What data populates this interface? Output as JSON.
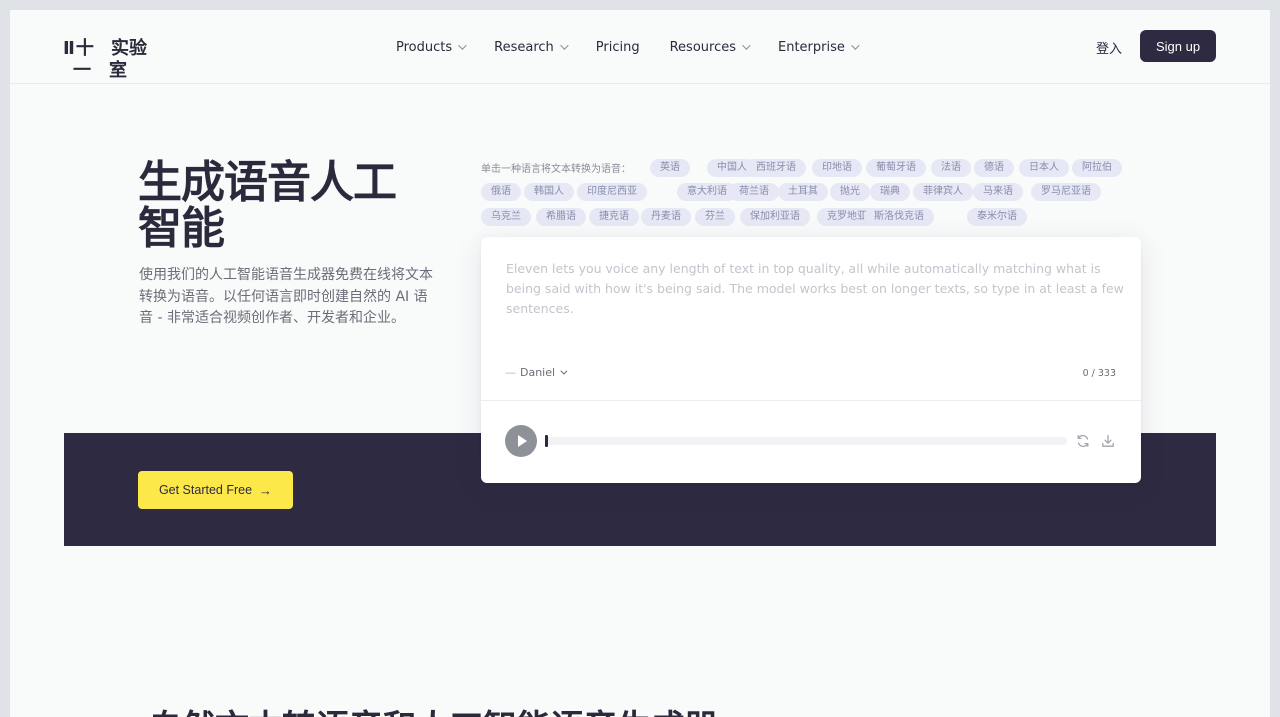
{
  "logo": {
    "line1_left": "Ⅱ十",
    "line1_right": "实验",
    "line2_left": "一",
    "line2_right": "室"
  },
  "nav": [
    {
      "label": "Products",
      "dropdown": true
    },
    {
      "label": "Research",
      "dropdown": true
    },
    {
      "label": "Pricing",
      "dropdown": false
    },
    {
      "label": "Resources",
      "dropdown": true
    },
    {
      "label": "Enterprise",
      "dropdown": true
    }
  ],
  "header": {
    "login_label": "登入",
    "signup_label": "Sign up"
  },
  "hero": {
    "title": " 生成语音人工智能",
    "description": "使用我们的人工智能语音生成器免费在线将文本转换为语音。以任何语言即时创建自然的 AI 语音 - 非常适合视频创作者、开发者和企业。",
    "cta_label": "Get Started Free"
  },
  "languages": {
    "prompt": "单击一种语言将文本转换为语音：",
    "items": [
      "英语",
      "中国人",
      "西班牙语",
      "印地语",
      "葡萄牙语",
      "法语",
      "德语",
      "日本人",
      "阿拉伯",
      "俄语",
      "韩国人",
      "印度尼西亚",
      "意大利语",
      "荷兰语",
      "土耳其",
      "抛光",
      "瑞典",
      "菲律宾人",
      "马来语",
      "罗马尼亚语",
      "乌克兰",
      "希腊语",
      "捷克语",
      "丹麦语",
      "芬兰",
      "保加利亚语",
      "克罗地亚语",
      "斯洛伐克语",
      "泰米尔语"
    ]
  },
  "tts_card": {
    "placeholder": "Eleven lets you voice any length of text in top quality, all while automatically matching what is being said with how it's being said. The model works best on longer texts, so type in at least a few sentences.",
    "voice_label": "Daniel",
    "char_counter": "0 / 333"
  },
  "next_section": {
    "title": "自然文本转语音和人工智能语音生成器"
  },
  "colors": {
    "dark": "#2d2a41",
    "accent_yellow": "#fde84a",
    "chip_bg": "#e6e8f6"
  }
}
